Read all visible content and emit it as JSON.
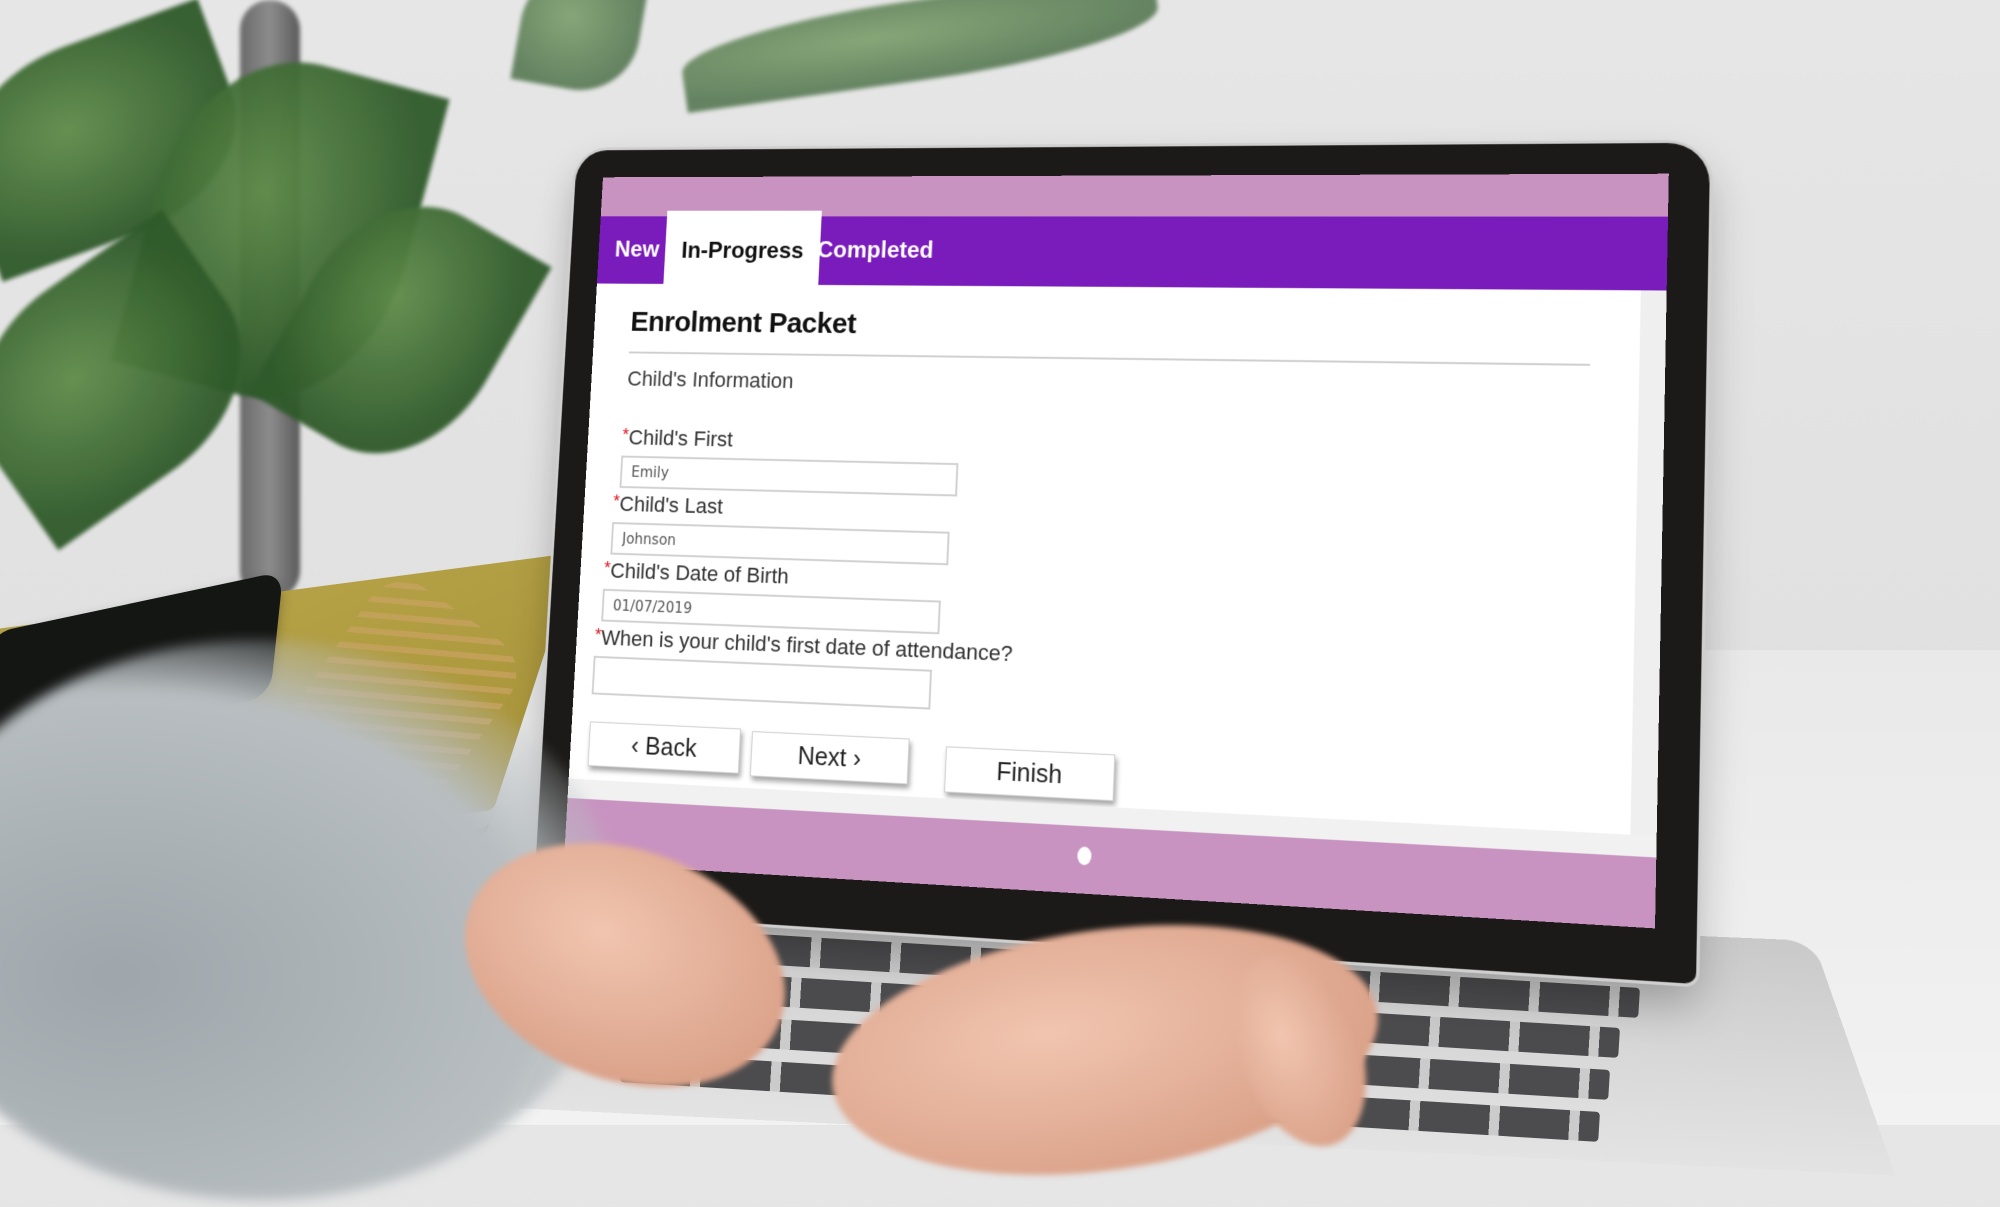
{
  "app": {
    "tabs": [
      {
        "label": "New",
        "active": false
      },
      {
        "label": "In-Progress",
        "active": true
      },
      {
        "label": "Completed",
        "active": false
      }
    ],
    "colors": {
      "tab_bar": "#7a1cbc",
      "accent_band": "#c993c1",
      "required_marker": "#e0101a"
    }
  },
  "form": {
    "title": "Enrolment Packet",
    "section": "Child's Information",
    "required_marker": "*",
    "fields": [
      {
        "label": "Child's First",
        "value": "Emily",
        "required": true
      },
      {
        "label": "Child's Last",
        "value": "Johnson",
        "required": true
      },
      {
        "label": "Child's Date of Birth",
        "value": "01/07/2019",
        "required": true
      },
      {
        "label": "When is your child's first date of attendance?",
        "value": "",
        "required": true
      }
    ]
  },
  "buttons": {
    "back": "‹  Back",
    "next": "Next ›",
    "finish": "Finish"
  },
  "pagination": {
    "current_page": 1,
    "total_pages": 1
  }
}
